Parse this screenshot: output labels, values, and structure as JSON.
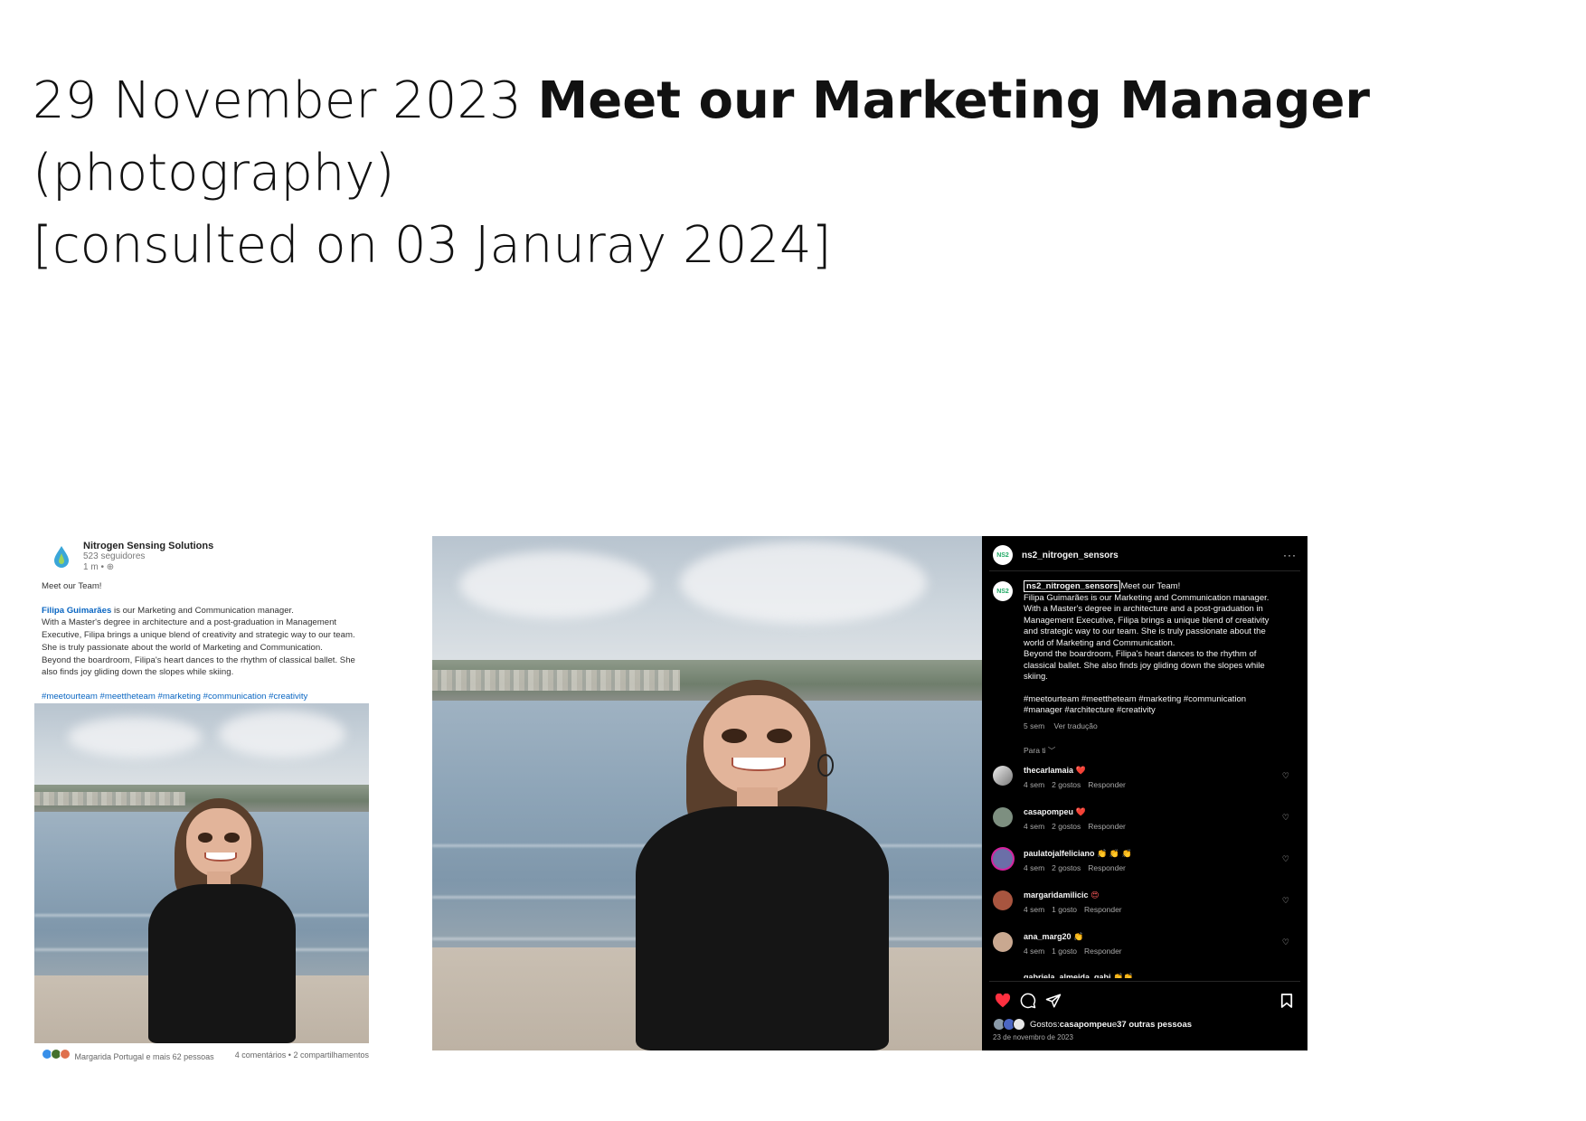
{
  "header": {
    "date": "29 November 2023",
    "title": "Meet our Marketing Manager",
    "line2": "(photography)",
    "line3": "[consulted on 03 Januray 2024]"
  },
  "linkedin": {
    "company": "Nitrogen Sensing Solutions",
    "followers": "523 seguidores",
    "time": "1 m •",
    "intro": "Meet our Team!",
    "person_link": "Filipa Guimarães",
    "line1_rest": " is our Marketing and Communication manager.",
    "line2": "With a Master's degree in architecture and a post-graduation in Management",
    "line3": "Executive, Filipa brings a unique blend of creativity and strategic way to our team.",
    "line4": "She is truly passionate about the world of Marketing and Communication.",
    "line5": "Beyond the boardroom, Filipa's heart dances to the rhythm of classical ballet. She",
    "line6": "also finds joy gliding down the slopes while skiing.",
    "hashtags": "#meetourteam #meettheteam #marketing #communication #creativity",
    "reactions": "Margarida Portugal e mais 62 pessoas",
    "stats": "4 comentários • 2 compartilhamentos"
  },
  "instagram": {
    "username": "ns2_nitrogen_sensors",
    "more": "···",
    "avatar_text": "NS2",
    "caption_user": "ns2_nitrogen_sensors",
    "caption_lines": [
      "Meet our Team!",
      "Filipa Guimarães is our Marketing and Communication manager.",
      "With a Master's degree in architecture and a post-graduation in",
      "Management Executive, Filipa brings a unique blend of creativity",
      "and strategic way to our team. She is truly passionate about the",
      "world of Marketing and Communication.",
      "Beyond the boardroom, Filipa's heart dances to the rhythm of",
      "classical ballet. She also finds joy gliding down the slopes while",
      "skiing."
    ],
    "hashtags1": "#meetourteam #meettheteam #marketing #communication",
    "hashtags2": "#manager #architecture #creativity",
    "post_age": "5 sem",
    "translate": "Ver tradução",
    "para_ti": "Para ti ﹀",
    "comments": [
      {
        "user": "thecarlamaia",
        "emoji": "❤️",
        "age": "4 sem",
        "likes": "2 gostos",
        "reply": "Responder"
      },
      {
        "user": "casapompeu",
        "emoji": "❤️",
        "age": "4 sem",
        "likes": "2 gostos",
        "reply": "Responder"
      },
      {
        "user": "paulatojalfeliciano",
        "emoji": "👏 👏 👏",
        "age": "4 sem",
        "likes": "2 gostos",
        "reply": "Responder"
      },
      {
        "user": "margaridamilicic",
        "emoji": "😍",
        "age": "4 sem",
        "likes": "1 gosto",
        "reply": "Responder"
      },
      {
        "user": "ana_marg20",
        "emoji": "👏",
        "age": "4 sem",
        "likes": "1 gosto",
        "reply": "Responder"
      }
    ],
    "partial_comment": "gabriela_almeida_gabi 👏👏",
    "likes_prefix": "Gostos: ",
    "likes_user": "casapompeu",
    "likes_mid": " e ",
    "likes_others": "37 outras pessoas",
    "date": "23 de novembro de 2023"
  },
  "colors": {
    "linkedin_blue": "#0a66c2",
    "instagram_red": "#ff3040",
    "panel_bg": "#000000"
  }
}
